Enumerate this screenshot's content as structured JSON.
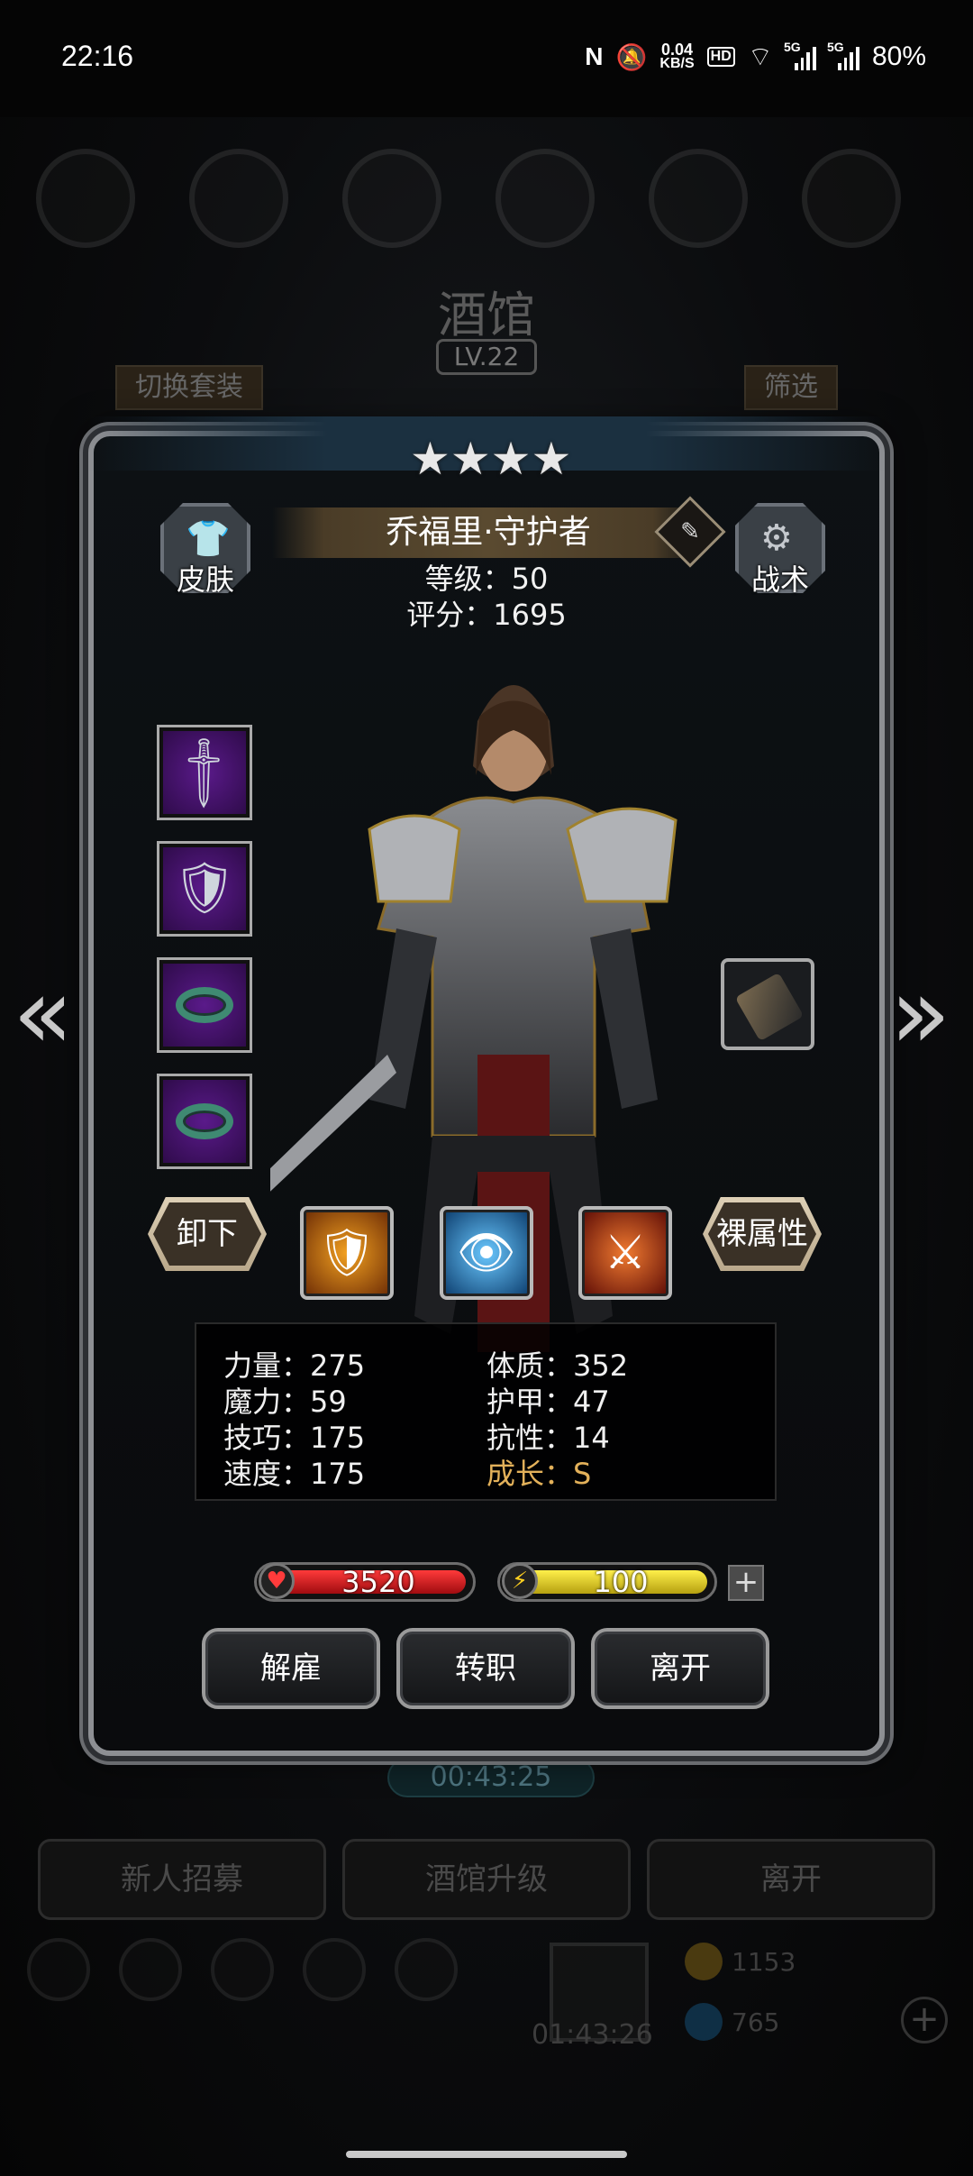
{
  "status_bar": {
    "time": "22:16",
    "net_speed_value": "0.04",
    "net_speed_unit": "KB/S",
    "hd_badge": "HD",
    "sim1_label": "5G",
    "sim2_label": "5G",
    "battery": "80%"
  },
  "background": {
    "title": "酒馆",
    "level": "LV.22",
    "switch_set": "切换套装",
    "filter": "筛选",
    "timer": "00:43:25",
    "buttons": [
      "新人招募",
      "酒馆升级",
      "离开"
    ],
    "gift_timer": "01:43:26",
    "resource_1": "1153",
    "resource_2": "765"
  },
  "hero": {
    "stars": 4,
    "name": "乔福里·守护者",
    "level_line": "等级：50",
    "score_line": "评分：1695"
  },
  "corner_buttons": {
    "skin": "皮肤",
    "tactics": "战术"
  },
  "equipment": [
    "sword",
    "armor",
    "ring",
    "ring"
  ],
  "buttons": {
    "unequip": "卸下",
    "base_attr": "裸属性"
  },
  "skills": [
    "shield-skill",
    "eye-skill",
    "slash-skill"
  ],
  "stats": {
    "strength": "力量：275",
    "magic": "魔力：59",
    "skill": "技巧：175",
    "speed": "速度：175",
    "constitution": "体质：352",
    "armor": "护甲：47",
    "resist": "抗性：14",
    "growth": "成长：S"
  },
  "bars": {
    "hp": "3520",
    "energy": "100",
    "plus": "+"
  },
  "actions": {
    "dismiss": "解雇",
    "change_class": "转职",
    "leave": "离开"
  },
  "colors": {
    "growth": "#e3b15a",
    "hp_fill": "#c4161c",
    "energy_fill": "#d8c21a",
    "equip_slot": "#5a1a8a"
  }
}
